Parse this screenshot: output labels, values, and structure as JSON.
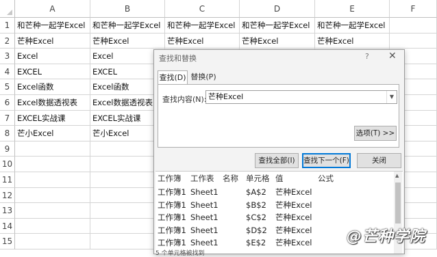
{
  "columns": [
    "A",
    "B",
    "C",
    "D",
    "E",
    "F"
  ],
  "rows": [
    "1",
    "2",
    "3",
    "4",
    "5",
    "6",
    "7",
    "8",
    "9",
    "10",
    "11",
    "12",
    "13",
    "14",
    "15"
  ],
  "cells": [
    [
      "和芒种一起学Excel",
      "和芒种一起学Excel",
      "和芒种一起学Excel",
      "和芒种一起学Excel",
      "和芒种一起学Excel"
    ],
    [
      "芒种Excel",
      "芒种Excel",
      "芒种Excel",
      "芒种Excel",
      "芒种Excel"
    ],
    [
      "Excel",
      "Excel"
    ],
    [
      "EXCEL",
      "EXCEL"
    ],
    [
      "Excel函数",
      "Excel函数"
    ],
    [
      "Excel数据透视表",
      "Excel数据透视表"
    ],
    [
      "EXCEL实战课",
      "EXCEL实战课"
    ],
    [
      "芒小Excel",
      "芒小Excel"
    ]
  ],
  "dialog": {
    "title": "查找和替换",
    "help": "?",
    "close": "✕",
    "tabs": {
      "find": "查找(D)",
      "replace": "替换(P)"
    },
    "find_label": "查找内容(N):",
    "find_value": "芒种Excel",
    "options_btn": "选项(T) >>",
    "find_all_btn": "查找全部(I)",
    "find_next_btn": "查找下一个(F)",
    "close_btn": "关闭",
    "results_headers": [
      "工作簿",
      "工作表",
      "名称",
      "单元格",
      "值",
      "公式"
    ],
    "results_rows": [
      [
        "工作簿1",
        "Sheet1",
        "",
        "$A$2",
        "芒种Excel",
        ""
      ],
      [
        "工作簿1",
        "Sheet1",
        "",
        "$B$2",
        "芒种Excel",
        ""
      ],
      [
        "工作簿1",
        "Sheet1",
        "",
        "$C$2",
        "芒种Excel",
        ""
      ],
      [
        "工作簿1",
        "Sheet1",
        "",
        "$D$2",
        "芒种Excel",
        ""
      ],
      [
        "工作簿1",
        "Sheet1",
        "",
        "$E$2",
        "芒种Excel",
        ""
      ]
    ],
    "status": "5 个单元格被找到"
  },
  "watermark": "@芒种学院",
  "colors": {
    "grid": "#d4d4d4",
    "dialog_bg": "#f3f3f3",
    "accent": "#0078d7"
  }
}
